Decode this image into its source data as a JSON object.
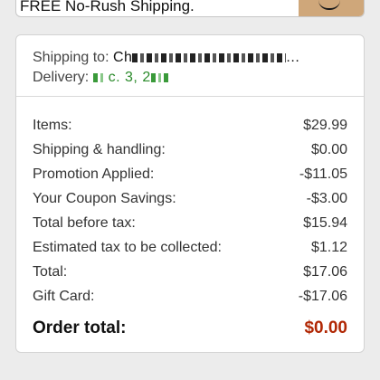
{
  "banner": {
    "text": "FREE No-Rush Shipping."
  },
  "shipping": {
    "label": "Shipping to:",
    "value_visible": "Ch",
    "value_tail": "...",
    "delivery_label": "Delivery:",
    "delivery_value": "c. 3, 2"
  },
  "summary": {
    "rows": [
      {
        "label": "Items:",
        "amount": "$29.99"
      },
      {
        "label": "Shipping & handling:",
        "amount": "$0.00"
      },
      {
        "label": "Promotion Applied:",
        "amount": "-$11.05"
      },
      {
        "label": "Your Coupon Savings:",
        "amount": "-$3.00"
      },
      {
        "label": "Total before tax:",
        "amount": "$15.94"
      },
      {
        "label": "Estimated tax to be collected:",
        "amount": "$1.12"
      },
      {
        "label": "Total:",
        "amount": "$17.06"
      },
      {
        "label": "Gift Card:",
        "amount": "-$17.06"
      }
    ],
    "order_total_label": "Order total:",
    "order_total_amount": "$0.00"
  },
  "colors": {
    "order_total": "#b12704",
    "delivery": "#2a8a2a"
  }
}
